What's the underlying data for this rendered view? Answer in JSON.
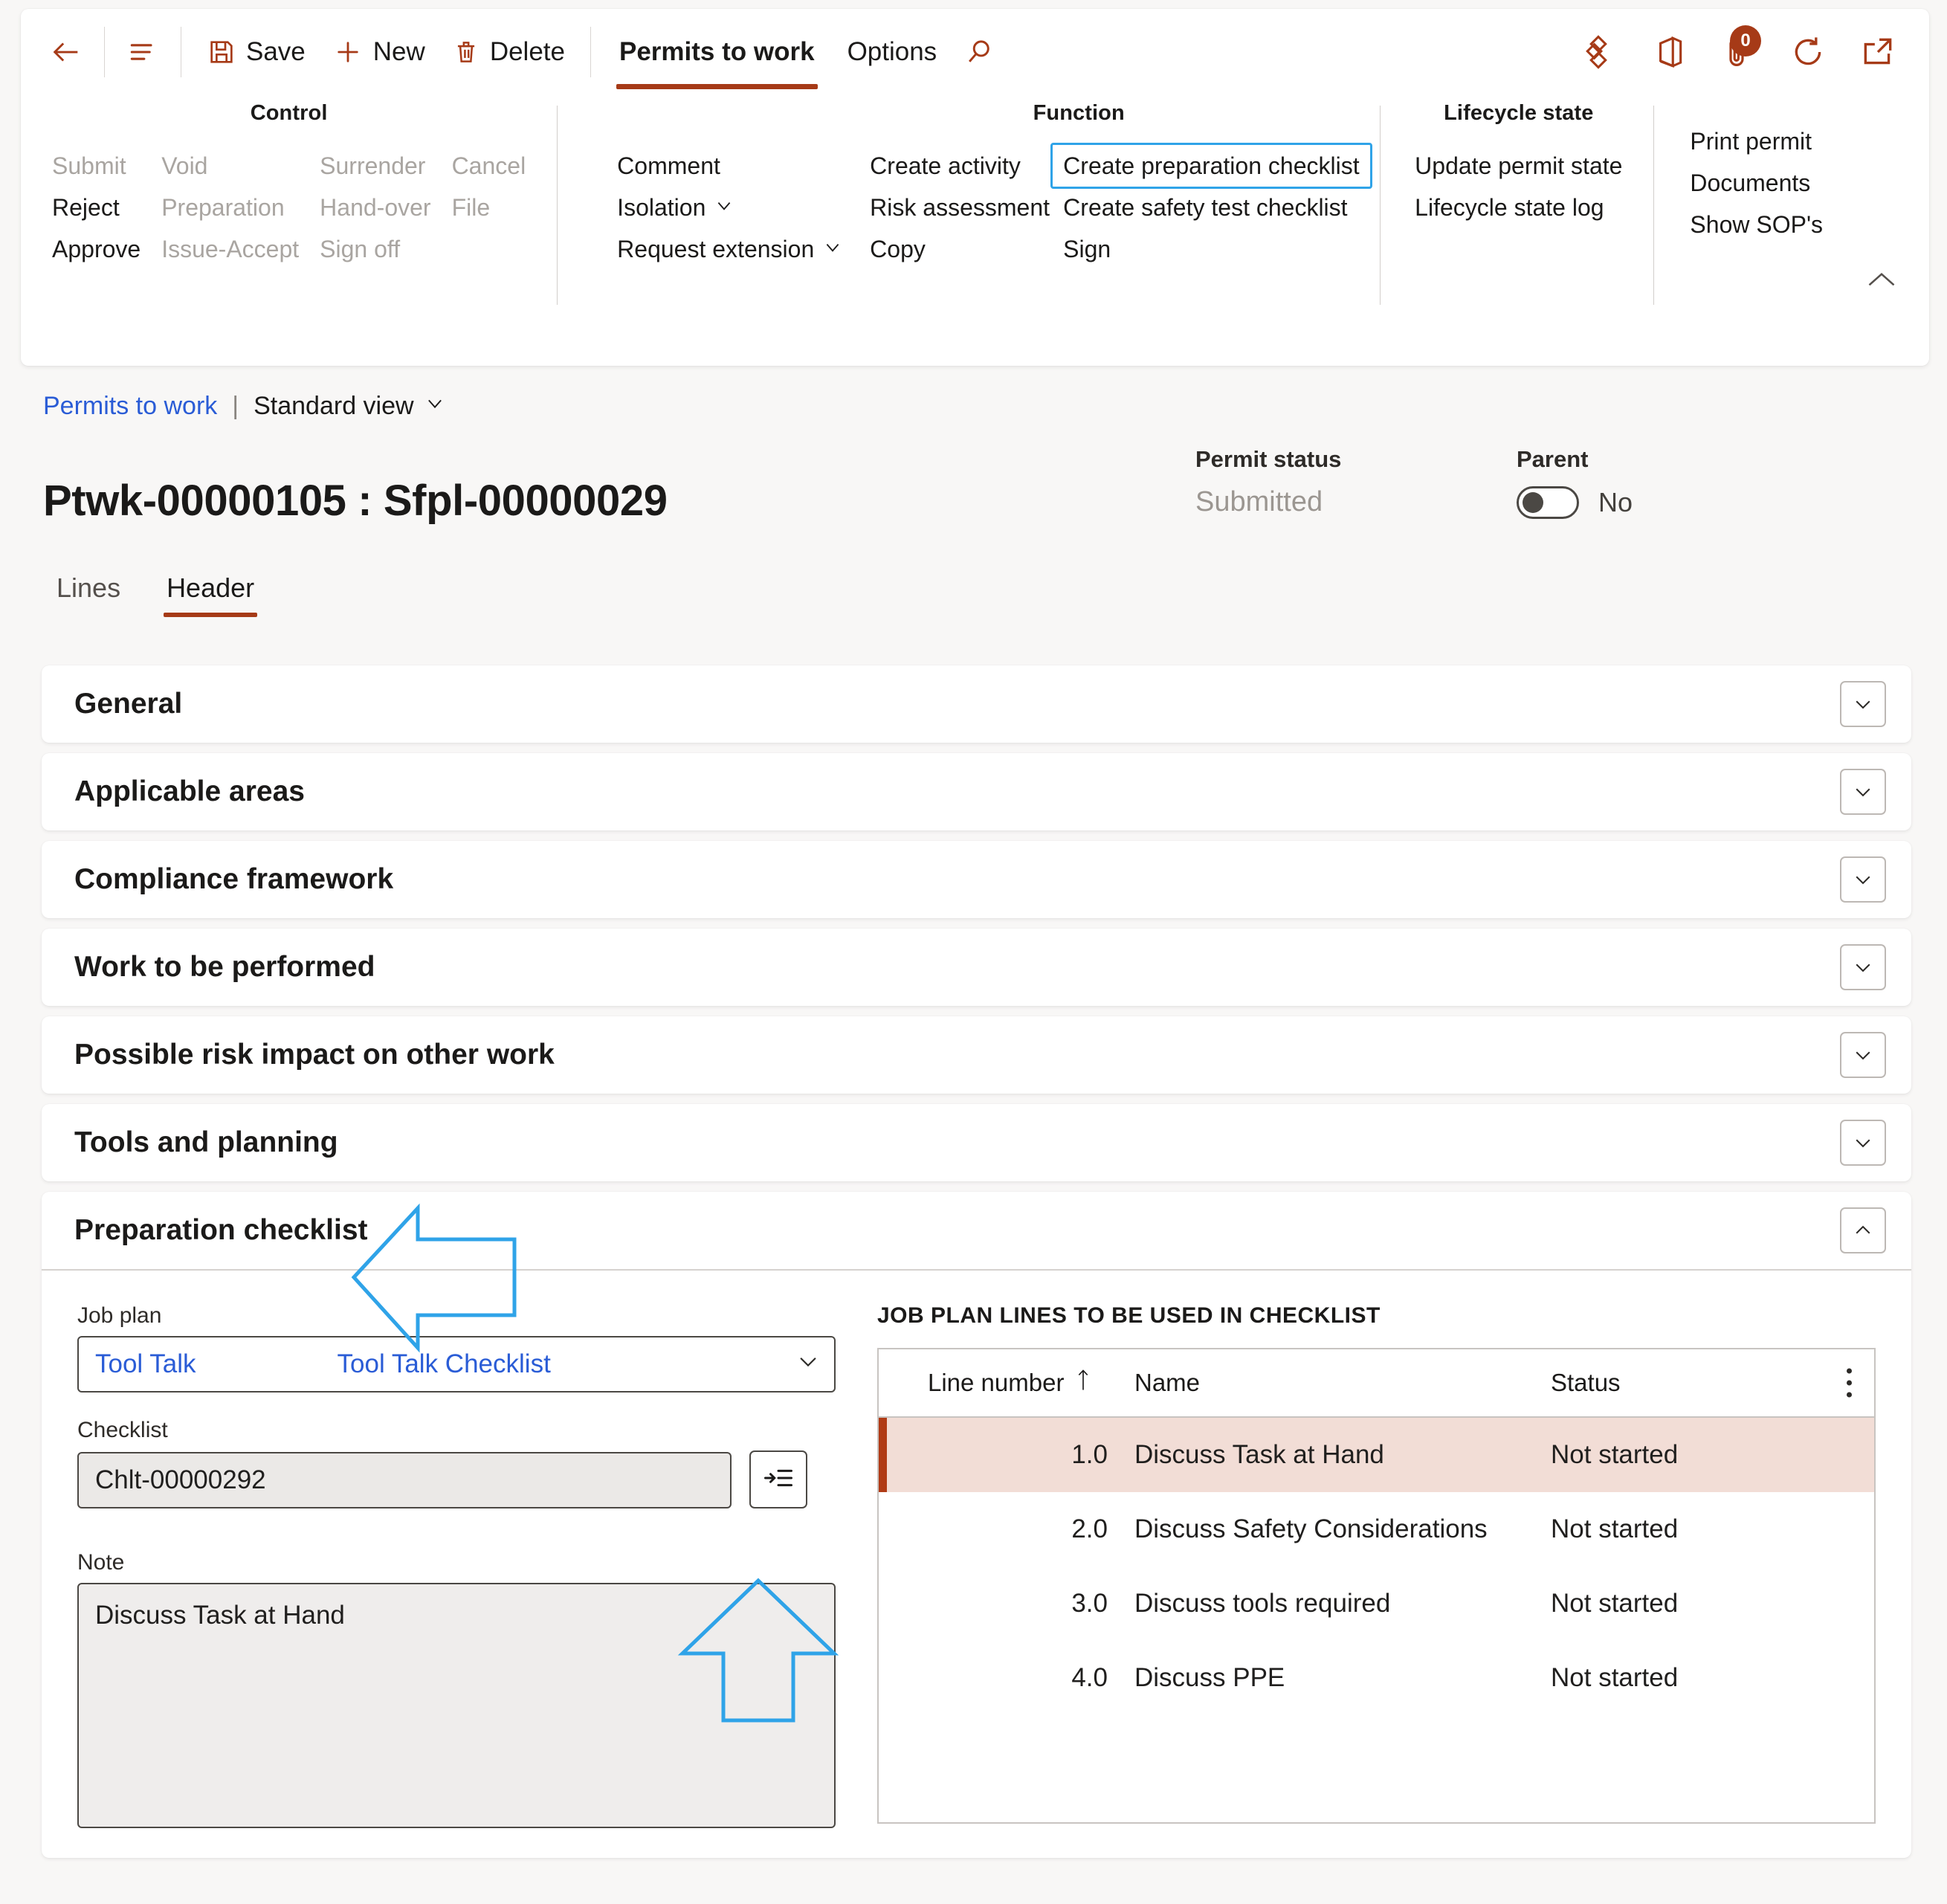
{
  "colors": {
    "accent": "#a63a17",
    "link": "#2a5cd6",
    "annotation": "#2fa3e8",
    "selected_row_bg": "#f2ddd6",
    "selected_row_bar": "#b03b16"
  },
  "commandbar": {
    "back_label": "Back",
    "showlist_label": "Show list",
    "save_label": "Save",
    "new_label": "New",
    "delete_label": "Delete",
    "tabs": [
      {
        "label": "Permits to work",
        "active": true
      },
      {
        "label": "Options",
        "active": false
      }
    ],
    "search_label": "Search",
    "right_icons": [
      {
        "name": "power-apps-icon",
        "label": "Power Apps"
      },
      {
        "name": "office-apps-icon",
        "label": "Office apps"
      },
      {
        "name": "attachments-icon",
        "label": "Attachments",
        "badge": "0"
      },
      {
        "name": "refresh-icon",
        "label": "Refresh"
      },
      {
        "name": "open-in-new-window-icon",
        "label": "Open in new window"
      }
    ]
  },
  "ribbon": {
    "collapse_label": "Collapse the ribbon",
    "groups": [
      {
        "title": "Control",
        "columns": [
          [
            {
              "label": "Submit",
              "disabled": true
            },
            {
              "label": "Reject",
              "disabled": false
            },
            {
              "label": "Approve",
              "disabled": false
            }
          ],
          [
            {
              "label": "Void",
              "disabled": true
            },
            {
              "label": "Preparation",
              "disabled": true
            },
            {
              "label": "Issue-Accept",
              "disabled": true
            }
          ],
          [
            {
              "label": "Surrender",
              "disabled": true
            },
            {
              "label": "Hand-over",
              "disabled": true
            },
            {
              "label": "Sign off",
              "disabled": true
            }
          ],
          [
            {
              "label": "Cancel",
              "disabled": true
            },
            {
              "label": "File",
              "disabled": true
            }
          ]
        ]
      },
      {
        "title": "Function",
        "columns": [
          [
            {
              "label": "Comment",
              "disabled": false
            },
            {
              "label": "Isolation",
              "disabled": false,
              "caret": true
            },
            {
              "label": "Request extension",
              "disabled": false,
              "caret": true
            }
          ],
          [
            {
              "label": "Create activity",
              "disabled": false
            },
            {
              "label": "Risk assessment",
              "disabled": false
            },
            {
              "label": "Copy",
              "disabled": false
            }
          ],
          [
            {
              "label": "Create preparation checklist",
              "disabled": false,
              "highlight": true
            },
            {
              "label": "Create safety test checklist",
              "disabled": false
            },
            {
              "label": "Sign",
              "disabled": false
            }
          ]
        ]
      },
      {
        "title": "Lifecycle state",
        "columns": [
          [
            {
              "label": "Update permit state",
              "disabled": false
            },
            {
              "label": "Lifecycle state log",
              "disabled": false
            }
          ]
        ]
      },
      {
        "title": "",
        "columns": [
          [
            {
              "label": "Print permit",
              "disabled": false
            },
            {
              "label": "Documents",
              "disabled": false
            },
            {
              "label": "Show SOP's",
              "disabled": false
            }
          ]
        ]
      }
    ]
  },
  "breadcrumb": {
    "root": "Permits to work",
    "separator": "|",
    "view": "Standard view"
  },
  "header": {
    "title": "Ptwk-00000105 : Sfpl-00000029",
    "permit_status_label": "Permit status",
    "permit_status_value": "Submitted",
    "parent_label": "Parent",
    "parent_value": "No",
    "parent_on": false
  },
  "tabs": [
    {
      "label": "Lines",
      "active": false
    },
    {
      "label": "Header",
      "active": true
    }
  ],
  "sections": [
    {
      "title": "General",
      "expanded": false
    },
    {
      "title": "Applicable areas",
      "expanded": false
    },
    {
      "title": "Compliance framework",
      "expanded": false
    },
    {
      "title": "Work to be performed",
      "expanded": false
    },
    {
      "title": "Possible risk impact on other work",
      "expanded": false
    },
    {
      "title": "Tools and planning",
      "expanded": false
    },
    {
      "title": "Preparation checklist",
      "expanded": true
    }
  ],
  "preparation_checklist": {
    "job_plan_label": "Job plan",
    "job_plan_id": "Tool Talk",
    "job_plan_name": "Tool Talk Checklist",
    "checklist_label": "Checklist",
    "checklist_value": "Chlt-00000292",
    "open_checklist_button_label": "Open checklist lines",
    "note_label": "Note",
    "note_value": "Discuss Task at Hand",
    "grid_caption": "JOB PLAN LINES TO BE USED IN CHECKLIST",
    "grid_menu_label": "Grid options",
    "columns": [
      {
        "label": "Line number",
        "sort": "asc"
      },
      {
        "label": "Name",
        "sort": ""
      },
      {
        "label": "Status",
        "sort": ""
      }
    ],
    "rows": [
      {
        "line_number": "1.0",
        "name": "Discuss Task at Hand",
        "status": "Not started",
        "selected": true
      },
      {
        "line_number": "2.0",
        "name": "Discuss Safety Considerations",
        "status": "Not started",
        "selected": false
      },
      {
        "line_number": "3.0",
        "name": "Discuss tools required",
        "status": "Not started",
        "selected": false
      },
      {
        "line_number": "4.0",
        "name": "Discuss PPE",
        "status": "Not started",
        "selected": false
      }
    ]
  },
  "annotations": [
    {
      "name": "arrow-pointing-to-preparation-checklist",
      "direction": "left"
    },
    {
      "name": "arrow-pointing-to-open-checklist-button",
      "direction": "up"
    }
  ]
}
